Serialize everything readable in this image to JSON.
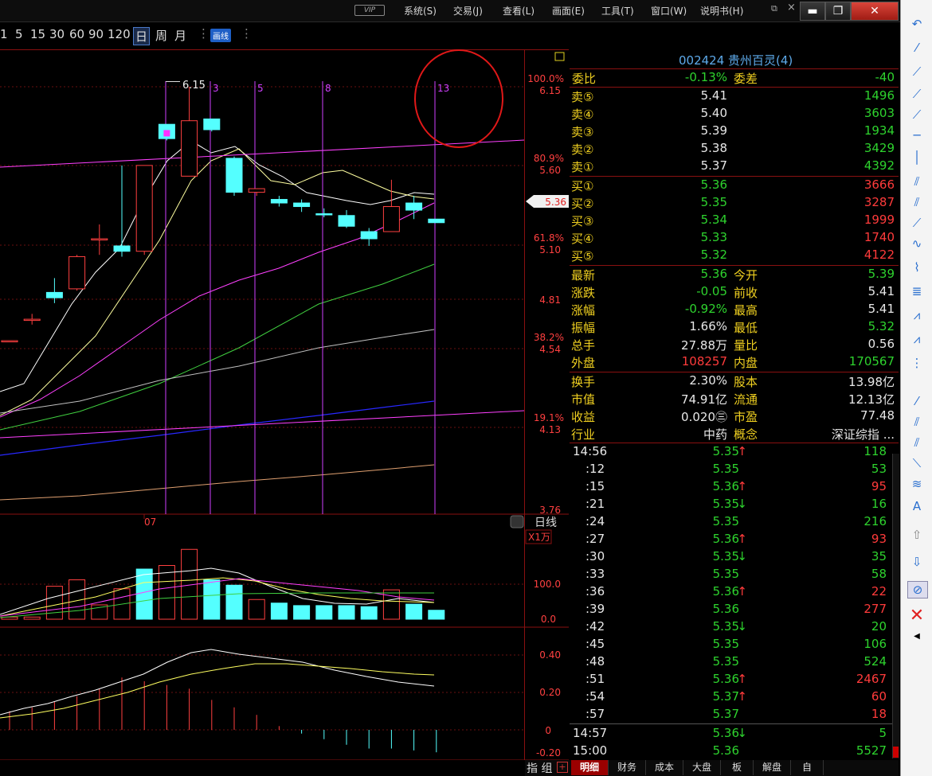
{
  "titlebar": {
    "vip": "VIP",
    "menus": [
      "系统(S)",
      "交易(J)",
      "查看(L)",
      "画面(E)",
      "工具(T)",
      "窗口(W)",
      "说明书(H)"
    ]
  },
  "toolbar": {
    "periods": [
      "1",
      "5",
      "15",
      "30",
      "60",
      "90",
      "120",
      "日",
      "周",
      "月"
    ],
    "draw_label": "画线"
  },
  "chart": {
    "right_labels": {
      "p100": "100.0%",
      "v615": "6.15",
      "p809": "80.9%",
      "v560": "5.60",
      "cur": "5.36",
      "p618": "61.8%",
      "v510": "5.10",
      "v481": "4.81",
      "p382": "38.2%",
      "v454": "4.54",
      "p191": "19.1%",
      "v413": "4.13",
      "v376": "3.76"
    },
    "high_label": "6.15",
    "line_labels": [
      "3",
      "5",
      "8",
      "13"
    ],
    "date_label": "07",
    "period_label": "日线",
    "vol_unit": "X1万",
    "vol_ticks": [
      "100.0",
      "0.0"
    ],
    "macd_ticks": [
      "0.40",
      "0.20",
      "0",
      "-0.20"
    ],
    "indicator_tab": "指 组"
  },
  "chart_data": {
    "type": "candlestick",
    "ylim": [
      3.76,
      6.15
    ],
    "candles": [
      {
        "o": 4.73,
        "c": 4.73,
        "h": 4.73,
        "l": 4.73,
        "dir": "up"
      },
      {
        "o": 4.85,
        "c": 4.85,
        "h": 4.88,
        "l": 4.82,
        "dir": "up"
      },
      {
        "o": 5.0,
        "c": 4.97,
        "h": 5.08,
        "l": 4.94,
        "dir": "down"
      },
      {
        "o": 5.02,
        "c": 5.2,
        "h": 5.21,
        "l": 5.01,
        "dir": "up"
      },
      {
        "o": 5.3,
        "c": 5.3,
        "h": 5.38,
        "l": 5.21,
        "dir": "up"
      },
      {
        "o": 5.26,
        "c": 5.23,
        "h": 5.71,
        "l": 5.2,
        "dir": "down"
      },
      {
        "o": 5.23,
        "c": 5.71,
        "h": 5.71,
        "l": 5.21,
        "dir": "up"
      },
      {
        "o": 5.94,
        "c": 5.86,
        "h": 5.94,
        "l": 5.85,
        "dir": "down"
      },
      {
        "o": 5.65,
        "c": 5.96,
        "h": 6.15,
        "l": 5.65,
        "dir": "up"
      },
      {
        "o": 5.97,
        "c": 5.91,
        "h": 5.97,
        "l": 5.9,
        "dir": "down"
      },
      {
        "o": 5.75,
        "c": 5.56,
        "h": 5.76,
        "l": 5.54,
        "dir": "down"
      },
      {
        "o": 5.56,
        "c": 5.58,
        "h": 5.58,
        "l": 5.54,
        "dir": "up"
      },
      {
        "o": 5.52,
        "c": 5.5,
        "h": 5.54,
        "l": 5.48,
        "dir": "down"
      },
      {
        "o": 5.5,
        "c": 5.48,
        "h": 5.52,
        "l": 5.45,
        "dir": "down"
      },
      {
        "o": 5.44,
        "c": 5.44,
        "h": 5.47,
        "l": 5.42,
        "dir": "down"
      },
      {
        "o": 5.43,
        "c": 5.37,
        "h": 5.46,
        "l": 5.36,
        "dir": "down"
      },
      {
        "o": 5.34,
        "c": 5.3,
        "h": 5.36,
        "l": 5.26,
        "dir": "down"
      },
      {
        "o": 5.34,
        "c": 5.48,
        "h": 5.63,
        "l": 5.34,
        "dir": "up"
      },
      {
        "o": 5.5,
        "c": 5.46,
        "h": 5.54,
        "l": 5.41,
        "dir": "down"
      },
      {
        "o": 5.41,
        "c": 5.39,
        "h": 5.41,
        "l": 5.39,
        "dir": "down"
      }
    ],
    "volumes": [
      {
        "v": 6,
        "dir": "up"
      },
      {
        "v": 6,
        "dir": "up"
      },
      {
        "v": 92,
        "dir": "up"
      },
      {
        "v": 110,
        "dir": "up"
      },
      {
        "v": 40,
        "dir": "up"
      },
      {
        "v": 85,
        "dir": "up"
      },
      {
        "v": 140,
        "dir": "down"
      },
      {
        "v": 150,
        "dir": "up"
      },
      {
        "v": 195,
        "dir": "up"
      },
      {
        "v": 110,
        "dir": "down"
      },
      {
        "v": 95,
        "dir": "down"
      },
      {
        "v": 55,
        "dir": "up"
      },
      {
        "v": 45,
        "dir": "down"
      },
      {
        "v": 38,
        "dir": "down"
      },
      {
        "v": 38,
        "dir": "down"
      },
      {
        "v": 38,
        "dir": "down"
      },
      {
        "v": 35,
        "dir": "down"
      },
      {
        "v": 82,
        "dir": "up"
      },
      {
        "v": 42,
        "dir": "down"
      },
      {
        "v": 25,
        "dir": "down"
      }
    ],
    "macd": [
      0.1,
      0.12,
      0.15,
      0.18,
      0.22,
      0.28,
      0.26,
      0.24,
      0.22,
      0.16,
      0.12,
      0.08,
      0.02,
      -0.02,
      -0.05,
      -0.08,
      -0.1,
      -0.1,
      -0.11,
      -0.12
    ]
  },
  "quote": {
    "header": "002424 贵州百灵(4)",
    "weibi_label": "委比",
    "weibi": "-0.13%",
    "weicha_label": "委差",
    "weicha": "-40",
    "sells": [
      {
        "label": "卖⑤",
        "price": "5.41",
        "vol": "1496"
      },
      {
        "label": "卖④",
        "price": "5.40",
        "vol": "3603"
      },
      {
        "label": "卖③",
        "price": "5.39",
        "vol": "1934"
      },
      {
        "label": "卖②",
        "price": "5.38",
        "vol": "3429"
      },
      {
        "label": "卖①",
        "price": "5.37",
        "vol": "4392"
      }
    ],
    "buys": [
      {
        "label": "买①",
        "price": "5.36",
        "vol": "3666"
      },
      {
        "label": "买②",
        "price": "5.35",
        "vol": "3287"
      },
      {
        "label": "买③",
        "price": "5.34",
        "vol": "1999"
      },
      {
        "label": "买④",
        "price": "5.33",
        "vol": "1740"
      },
      {
        "label": "买⑤",
        "price": "5.32",
        "vol": "4122"
      }
    ],
    "stats": [
      {
        "l1": "最新",
        "v1": "5.36",
        "l2": "今开",
        "v2": "5.39",
        "c1": "green",
        "c2": "green"
      },
      {
        "l1": "涨跌",
        "v1": "-0.05",
        "l2": "前收",
        "v2": "5.41",
        "c1": "green",
        "c2": "white"
      },
      {
        "l1": "涨幅",
        "v1": "-0.92%",
        "l2": "最高",
        "v2": "5.41",
        "c1": "green",
        "c2": "white"
      },
      {
        "l1": "振幅",
        "v1": "1.66%",
        "l2": "最低",
        "v2": "5.32",
        "c1": "white",
        "c2": "green"
      },
      {
        "l1": "总手",
        "v1": "27.88万",
        "l2": "量比",
        "v2": "0.56",
        "c1": "white",
        "c2": "white"
      },
      {
        "l1": "外盘",
        "v1": "108257",
        "l2": "内盘",
        "v2": "170567",
        "c1": "red",
        "c2": "green"
      }
    ],
    "info": [
      {
        "l1": "换手",
        "v1": "2.30%",
        "l2": "股本",
        "v2": "13.98亿"
      },
      {
        "l1": "市值",
        "v1": "74.91亿",
        "l2": "流通",
        "v2": "12.13亿"
      },
      {
        "l1": "收益",
        "v1": "0.020㊂",
        "l2": "市盈",
        "v2": "77.48"
      },
      {
        "l1": "行业",
        "v1": "中药",
        "l2": "概念",
        "v2": "深证综指 ..."
      }
    ],
    "ticks": [
      {
        "t": "14:56",
        "p": "5.35",
        "a": "↑",
        "v": "118",
        "vc": "green"
      },
      {
        "t": ":12",
        "p": "5.35",
        "a": "",
        "v": "53",
        "vc": "green"
      },
      {
        "t": ":15",
        "p": "5.36",
        "a": "↑",
        "v": "95",
        "vc": "red"
      },
      {
        "t": ":21",
        "p": "5.35",
        "a": "↓",
        "v": "16",
        "vc": "green"
      },
      {
        "t": ":24",
        "p": "5.35",
        "a": "",
        "v": "216",
        "vc": "green"
      },
      {
        "t": ":27",
        "p": "5.36",
        "a": "↑",
        "v": "93",
        "vc": "red"
      },
      {
        "t": ":30",
        "p": "5.35",
        "a": "↓",
        "v": "35",
        "vc": "green"
      },
      {
        "t": ":33",
        "p": "5.35",
        "a": "",
        "v": "58",
        "vc": "green"
      },
      {
        "t": ":36",
        "p": "5.36",
        "a": "↑",
        "v": "22",
        "vc": "red"
      },
      {
        "t": ":39",
        "p": "5.36",
        "a": "",
        "v": "277",
        "vc": "red"
      },
      {
        "t": ":42",
        "p": "5.35",
        "a": "↓",
        "v": "20",
        "vc": "green"
      },
      {
        "t": ":45",
        "p": "5.35",
        "a": "",
        "v": "106",
        "vc": "green"
      },
      {
        "t": ":48",
        "p": "5.35",
        "a": "",
        "v": "524",
        "vc": "green"
      },
      {
        "t": ":51",
        "p": "5.36",
        "a": "↑",
        "v": "2467",
        "vc": "red"
      },
      {
        "t": ":54",
        "p": "5.37",
        "a": "↑",
        "v": "60",
        "vc": "red"
      },
      {
        "t": ":57",
        "p": "5.37",
        "a": "",
        "v": "18",
        "vc": "red"
      },
      {
        "t": "14:57",
        "p": "5.36",
        "a": "↓",
        "v": "5",
        "vc": "green"
      },
      {
        "t": "15:00",
        "p": "5.36",
        "a": "",
        "v": "5527",
        "vc": "green"
      }
    ]
  },
  "bottom_tabs": [
    "明细",
    "财务",
    "成本",
    "大盘",
    "板",
    "解盘",
    "自"
  ]
}
